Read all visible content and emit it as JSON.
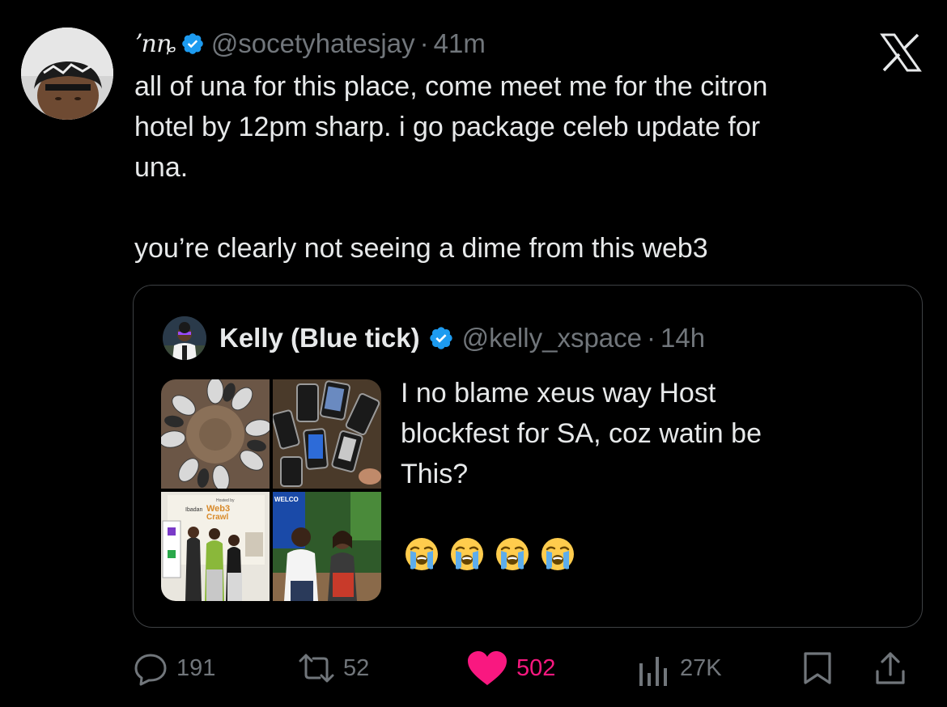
{
  "tweet": {
    "display_name": "ʼnȵ",
    "handle": "@socetyhatesjay",
    "separator": "·",
    "time": "41m",
    "text_lines": [
      "all of una for this place, come meet me for the citron",
      "hotel by 12pm sharp. i go package celeb update for",
      "una."
    ],
    "text_line_2": "you’re clearly not seeing a dime from this web3"
  },
  "quote": {
    "display_name": "Kelly (Blue tick)",
    "handle": "@kelly_xspace",
    "separator": "·",
    "time": "14h",
    "text_lines": [
      "I no blame xeus way Host",
      "blockfest for SA, coz watin be",
      "This?"
    ],
    "emojis": [
      "loudly-crying-face",
      "loudly-crying-face",
      "loudly-crying-face",
      "loudly-crying-face"
    ],
    "media_text": {
      "banner_small": "Hosted by",
      "banner_city": "Ibadan",
      "banner_title_1": "Web3",
      "banner_title_2": "Crawl",
      "welcome": "WELCO"
    }
  },
  "actions": {
    "replies": "191",
    "reposts": "52",
    "likes": "502",
    "views": "27K"
  },
  "colors": {
    "background": "#000000",
    "text": "#e7e9ea",
    "secondary": "#71767b",
    "verified": "#1d9bf0",
    "like": "#f91880"
  }
}
